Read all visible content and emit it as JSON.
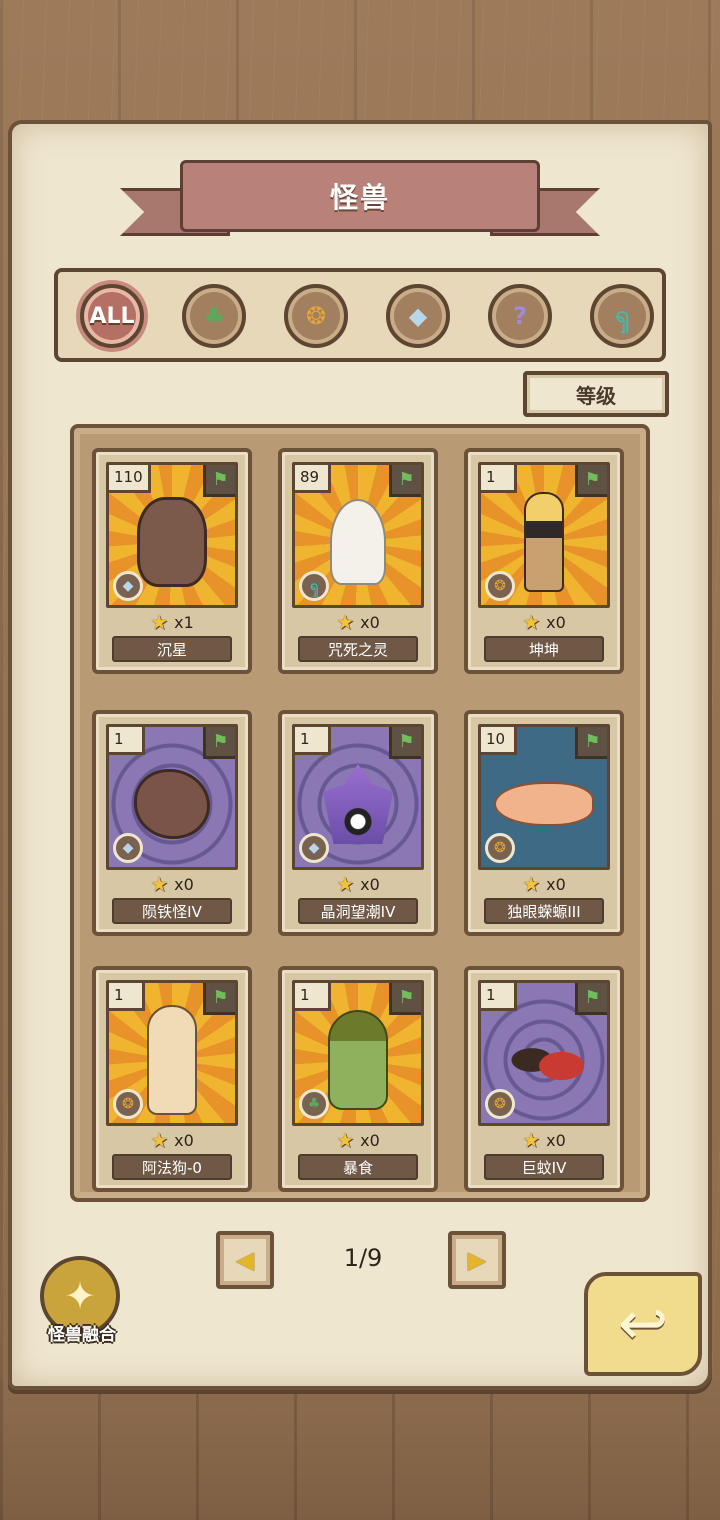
{
  "title": "怪兽",
  "filters": [
    {
      "name": "filter-all",
      "glyph": "ALL",
      "icon": "all-icon",
      "class": ""
    },
    {
      "name": "filter-plant",
      "glyph": "♣",
      "icon": "leaf-icon",
      "class": "g-leaf"
    },
    {
      "name": "filter-beast",
      "glyph": "❂",
      "icon": "paw-icon",
      "class": "g-paw"
    },
    {
      "name": "filter-mineral",
      "glyph": "◆",
      "icon": "crystal-icon",
      "class": "g-crystal"
    },
    {
      "name": "filter-unknown",
      "glyph": "?",
      "icon": "question-icon",
      "class": "g-question"
    },
    {
      "name": "filter-spirit",
      "glyph": "ၡ",
      "icon": "swirl-icon",
      "class": "g-swirl"
    }
  ],
  "sort_label": "等级",
  "cards": [
    {
      "level": "110",
      "stars": "x1",
      "name": "沉星",
      "bg": "gold",
      "type": "crystal",
      "monster": "golem"
    },
    {
      "level": "89",
      "stars": "x0",
      "name": "咒死之灵",
      "bg": "gold",
      "type": "swirl",
      "monster": "ghost"
    },
    {
      "level": "1",
      "stars": "x0",
      "name": "坤坤",
      "bg": "gold",
      "type": "paw",
      "monster": "human"
    },
    {
      "level": "1",
      "stars": "x0",
      "name": "陨铁怪IV",
      "bg": "purple",
      "type": "crystal",
      "monster": "rock"
    },
    {
      "level": "1",
      "stars": "x0",
      "name": "晶洞望潮IV",
      "bg": "purple",
      "type": "crystal",
      "monster": "crystal"
    },
    {
      "level": "10",
      "stars": "x0",
      "name": "独眼蝾螈III",
      "bg": "blue",
      "type": "paw",
      "monster": "newt"
    },
    {
      "level": "1",
      "stars": "x0",
      "name": "阿法狗-0",
      "bg": "gold",
      "type": "paw",
      "monster": "dog"
    },
    {
      "level": "1",
      "stars": "x0",
      "name": "暴食",
      "bg": "gold",
      "type": "leaf",
      "monster": "plantkid"
    },
    {
      "level": "1",
      "stars": "x0",
      "name": "巨蚊IV",
      "bg": "purple",
      "type": "paw",
      "monster": "mosquito"
    }
  ],
  "pager": {
    "prev": "◀",
    "next": "▶",
    "label": "1/9"
  },
  "fusion_label": "怪兽融合",
  "colors": {
    "parchment": "#efe6cf",
    "ribbon": "#b88279",
    "gold": "#f0b52f",
    "purple": "#8a78b4",
    "frame": "#6b5238"
  }
}
